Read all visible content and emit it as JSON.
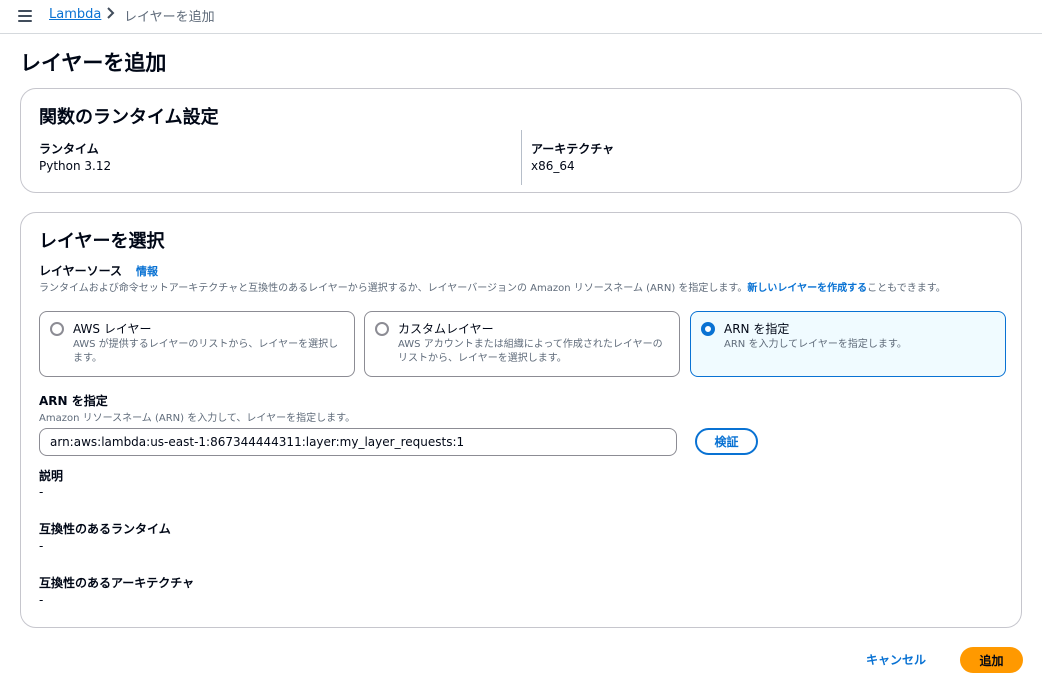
{
  "breadcrumb": {
    "parent": "Lambda",
    "current": "レイヤーを追加"
  },
  "page": {
    "title": "レイヤーを追加"
  },
  "runtime_settings": {
    "title": "関数のランタイム設定",
    "runtime_label": "ランタイム",
    "runtime_value": "Python 3.12",
    "arch_label": "アーキテクチャ",
    "arch_value": "x86_64"
  },
  "layer_select": {
    "title": "レイヤーを選択",
    "source_label": "レイヤーソース",
    "info_link": "情報",
    "source_desc": "ランタイムおよび命令セットアーキテクチャと互換性のあるレイヤーから選択するか、レイヤーバージョンの Amazon リソースネーム (ARN) を指定します。",
    "source_desc_link": "新しいレイヤーを作成する",
    "source_desc_tail": "こともできます。",
    "options": [
      {
        "title": "AWS レイヤー",
        "desc": "AWS が提供するレイヤーのリストから、レイヤーを選択します。",
        "selected": false
      },
      {
        "title": "カスタムレイヤー",
        "desc": "AWS アカウントまたは組織によって作成されたレイヤーのリストから、レイヤーを選択します。",
        "selected": false
      },
      {
        "title": "ARN を指定",
        "desc": "ARN を入力してレイヤーを指定します。",
        "selected": true
      }
    ],
    "arn_label": "ARN を指定",
    "arn_desc": "Amazon リソースネーム (ARN) を入力して、レイヤーを指定します。",
    "arn_value": "arn:aws:lambda:us-east-1:867344444311:layer:my_layer_requests:1",
    "verify_button": "検証",
    "description_label": "説明",
    "description_value": "-",
    "compat_runtime_label": "互換性のあるランタイム",
    "compat_runtime_value": "-",
    "compat_arch_label": "互換性のあるアーキテクチャ",
    "compat_arch_value": "-"
  },
  "footer": {
    "cancel": "キャンセル",
    "add": "追加"
  },
  "colors": {
    "link": "#0972d3",
    "primary": "#ff9900",
    "selected_tile_bg": "#f0fbff"
  }
}
